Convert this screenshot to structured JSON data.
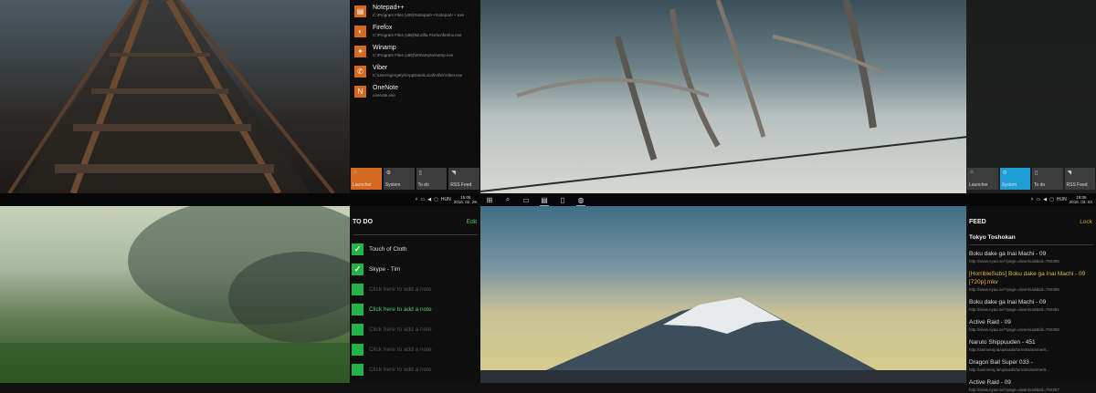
{
  "launcher": {
    "apps": [
      {
        "name": "Notepad++",
        "path": "C:\\Program Files (x86)\\Notepad++\\notepad++.exe",
        "icon": "notepad-icon"
      },
      {
        "name": "Firefox",
        "path": "C:\\Program Files (x86)\\Mozilla Firefox\\firefox.exe",
        "icon": "firefox-icon"
      },
      {
        "name": "Winamp",
        "path": "C:\\Program Files (x86)\\Winamp\\winamp.exe",
        "icon": "winamp-icon"
      },
      {
        "name": "Viber",
        "path": "C:\\Users\\gergelyh\\AppData\\Local\\Viber\\Viber.exe",
        "icon": "viber-icon"
      },
      {
        "name": "OneNote",
        "path": "onenote.exe",
        "icon": "onenote-icon"
      }
    ]
  },
  "tiles_left": {
    "launcher": "Launcher",
    "system": "System",
    "todo": "To do",
    "rss": "RSS Feed"
  },
  "tiles_right": {
    "launcher": "Launcher",
    "system": "System",
    "todo": "To do",
    "rss": "RSS Feed"
  },
  "taskbar_left": {
    "lang": "HUN",
    "time": "15:05",
    "date": "2016. 02. 29."
  },
  "taskbar_right": {
    "lang": "HUN",
    "time": "19:06",
    "date": "2016. 03. 03."
  },
  "todo": {
    "title": "TO DO",
    "edit_label": "Edit",
    "notes": [
      {
        "text": "Touch of Cloth",
        "checked": true
      },
      {
        "text": "Skype - Tim",
        "checked": true
      },
      {
        "text": "Click here to add a note",
        "checked": false
      },
      {
        "text": "Click here to add a note",
        "checked": false
      },
      {
        "text": "Click here to add a note",
        "checked": false
      },
      {
        "text": "Click here to add a note",
        "checked": false
      },
      {
        "text": "Click here to add a note",
        "checked": false
      }
    ]
  },
  "feed": {
    "title": "FEED",
    "lock_label": "Lock",
    "source": "Tokyo Toshokan",
    "items": [
      {
        "title": "Boku dake ga Inai Machi - 09",
        "url": "http://www.nyaa.se/?page=download&tid=790385"
      },
      {
        "title": "[HorribleSubs] Boku dake ga Inai Machi - 09 [720p].mkv",
        "url": "http://www.nyaa.se/?page=download&tid=790385"
      },
      {
        "title": "Boku dake ga Inai Machi - 09",
        "url": "http://www.nyaa.se/?page=download&tid=790381"
      },
      {
        "title": "Active Raid - 09",
        "url": "http://www.nyaa.se/?page=download&tid=790358"
      },
      {
        "title": "Naruto Shippuuden - 451",
        "url": "http://animeraj.la/uploads/torrents/anime/8..."
      },
      {
        "title": "Dragon Ball Super 033 -",
        "url": "http://animeraj.la/uploads/torrents/anime/8..."
      },
      {
        "title": "Active Raid - 09",
        "url": "http://www.nyaa.se/?page=download&tid=790357"
      }
    ]
  },
  "colors": {
    "accent_orange": "#d46a20",
    "accent_blue": "#1e9fd4",
    "todo_green": "#23b348",
    "feed_gold": "#c8a040",
    "link_green": "#4bd36a"
  }
}
